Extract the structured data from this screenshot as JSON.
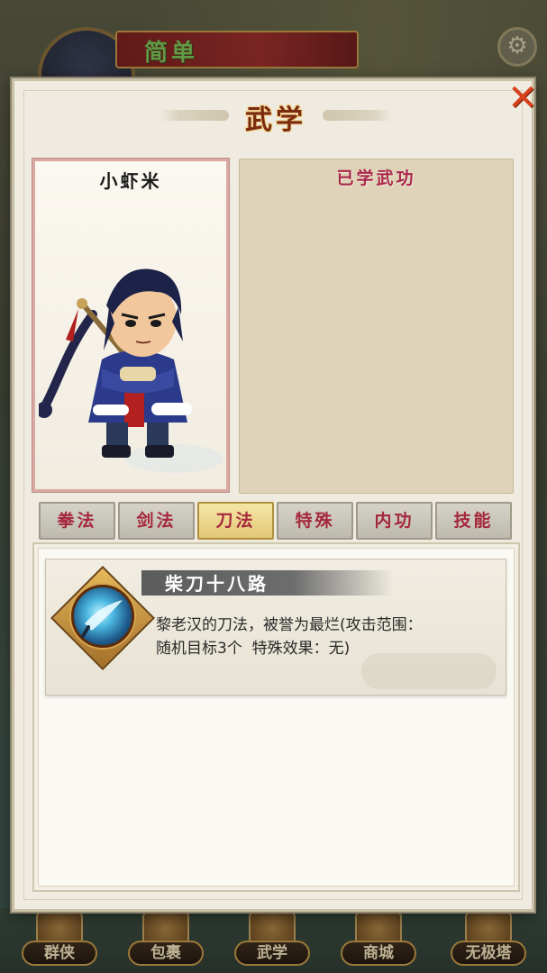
{
  "background": {
    "player_name": "简单",
    "settings_icon": "gear-icon"
  },
  "bottom_nav": [
    {
      "label": "群侠",
      "icon": "heroes-icon"
    },
    {
      "label": "包裹",
      "icon": "bag-icon"
    },
    {
      "label": "武学",
      "icon": "martial-arts-icon"
    },
    {
      "label": "商城",
      "icon": "shop-icon"
    },
    {
      "label": "无极塔",
      "icon": "tower-icon"
    }
  ],
  "dialog": {
    "title": "武学",
    "close_icon": "close-icon",
    "hero": {
      "name": "小虾米"
    },
    "learned": {
      "title": "已学武功"
    },
    "tabs": [
      {
        "label": "拳法",
        "active": false
      },
      {
        "label": "剑法",
        "active": false
      },
      {
        "label": "刀法",
        "active": true
      },
      {
        "label": "特殊",
        "active": false
      },
      {
        "label": "内功",
        "active": false
      },
      {
        "label": "技能",
        "active": false
      }
    ],
    "skills": [
      {
        "name": "柴刀十八路",
        "icon": "blade-skill-icon",
        "desc_line1": "黎老汉的刀法，被誉为最烂(攻击范围：",
        "desc_line2": "随机目标3个  特殊效果：无)"
      }
    ]
  },
  "colors": {
    "title": "#7a2a10",
    "tab_text": "#a5283c",
    "active_tab": "#e3c777",
    "close": "#d8421d",
    "learned_title": "#a8284e"
  }
}
